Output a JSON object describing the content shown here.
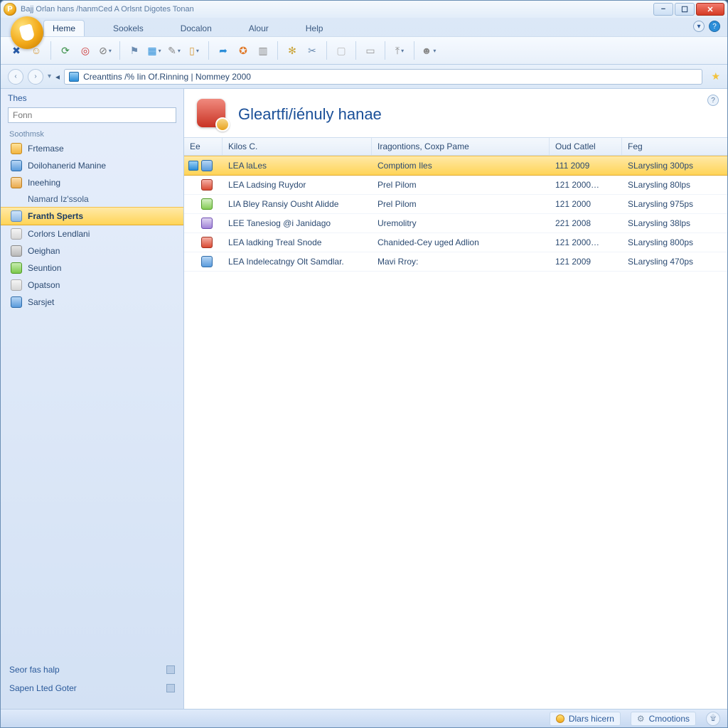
{
  "window": {
    "title": "Bajj Orlan hans /hanmCed A Orlsnt Digotes Tonan"
  },
  "tabs": {
    "items": [
      "Heme",
      "Sookels",
      "Docalon",
      "Alour",
      "Help"
    ],
    "active_index": 0
  },
  "address": {
    "value": "Creanttins /% Iin Of.Rinning | Nommey 2000"
  },
  "sidebar": {
    "title": "Thes",
    "search_placeholder": "Fonn",
    "category": "Soothmsk",
    "items": [
      {
        "label": "Frtemase"
      },
      {
        "label": "Doilohanerid Manine"
      },
      {
        "label": "Ineehing"
      },
      {
        "label": "Namard Iz'ssola",
        "indent": true
      },
      {
        "label": "Franth Sperts",
        "active": true
      },
      {
        "label": "Corlors Lendlani"
      },
      {
        "label": "Oeighan"
      },
      {
        "label": "Seuntion"
      },
      {
        "label": "Opatson"
      },
      {
        "label": "Sarsjet"
      }
    ],
    "footer": {
      "help": "Seor fas halp",
      "updates": "Sapen Lted Goter"
    }
  },
  "content": {
    "heading": "Gleartfi/iénuly hanae",
    "columns": {
      "c0": "Ee",
      "c1": "Kilos C.",
      "c2": "Iragontions, Coxp Pame",
      "c3": "Oud Catlel",
      "c4": "Feg"
    },
    "rows": [
      {
        "c1": "LEA laLes",
        "c2": "Comptiom Iles",
        "c3": "111 2009",
        "c4": "SLarysling 300ps",
        "selected": true
      },
      {
        "c1": "LEA Ladsing Ruydor",
        "c2": "Prel Pilom",
        "c3": "121 2000…",
        "c4": "SLarysling 80lps"
      },
      {
        "c1": "LIA Bley Ransiy Ousht Alidde",
        "c2": "Prel Pilom",
        "c3": "121 2000",
        "c4": "SLarysling 975ps"
      },
      {
        "c1": "LEE Tanesiog @i Janidago",
        "c2": "Uremolitry",
        "c3": "221 2008",
        "c4": "SLarysling 38lps"
      },
      {
        "c1": "LEA ladking Treal Snode",
        "c2": "Chanided-Cey uged Adlion",
        "c3": "121 2000…",
        "c4": "SLarysling 800ps"
      },
      {
        "c1": "LEA Indelecatngy Olt Samdlar.",
        "c2": "Mavi Rroy:",
        "c3": "121 2009",
        "c4": "SLarysling 470ps"
      }
    ]
  },
  "status": {
    "left": "Dlars hicern",
    "right": "Cmootions"
  }
}
